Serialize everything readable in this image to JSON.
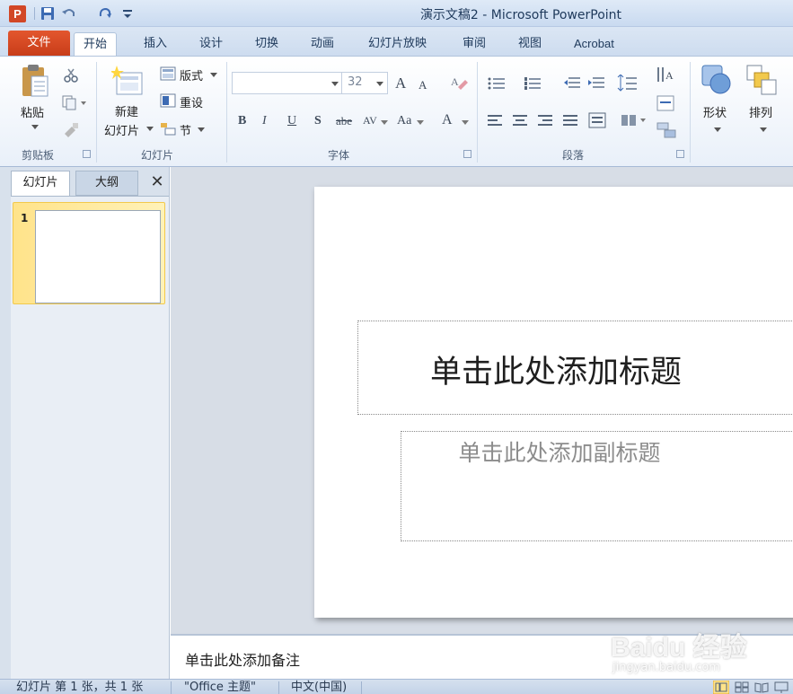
{
  "window": {
    "title": "演示文稿2 - Microsoft PowerPoint",
    "app_icon_letter": "P"
  },
  "ribbon_tabs": [
    {
      "label": "文件"
    },
    {
      "label": "开始"
    },
    {
      "label": "插入"
    },
    {
      "label": "设计"
    },
    {
      "label": "切换"
    },
    {
      "label": "动画"
    },
    {
      "label": "幻灯片放映"
    },
    {
      "label": "审阅"
    },
    {
      "label": "视图"
    },
    {
      "label": "Acrobat"
    }
  ],
  "ribbon": {
    "clipboard": {
      "paste_label": "粘贴",
      "group_label": "剪贴板"
    },
    "slides": {
      "new_slide_line1": "新建",
      "new_slide_line2": "幻灯片",
      "layout_label": "版式",
      "reset_label": "重设",
      "section_label": "节",
      "group_label": "幻灯片"
    },
    "font": {
      "font_name_value": "",
      "font_size_value": "32",
      "group_label": "字体",
      "bold": "B",
      "italic": "I",
      "underline": "U",
      "shadow": "S",
      "strike": "abe",
      "spacing": "AV",
      "case": "Aa",
      "color": "A",
      "grow": "A",
      "shrink": "A"
    },
    "paragraph": {
      "group_label": "段落"
    },
    "drawing": {
      "shapes_label": "形状",
      "arrange_label": "排列"
    }
  },
  "panel": {
    "tab_slides": "幻灯片",
    "tab_outline": "大纲",
    "close_glyph": "✕",
    "thumb_number": "1"
  },
  "slide": {
    "title_placeholder": "单击此处添加标题",
    "subtitle_placeholder": "单击此处添加副标题"
  },
  "notes": {
    "placeholder": "单击此处添加备注"
  },
  "status": {
    "slide_info": "幻灯片 第 1 张，共 1 张",
    "theme": "\"Office 主题\"",
    "language": "中文(中国)"
  },
  "watermark": {
    "brand": "Baidu 经验",
    "url": "jingyan.baidu.com"
  },
  "colors": {
    "file_tab": "#d24726",
    "selected_thumb": "#ffe38a"
  }
}
